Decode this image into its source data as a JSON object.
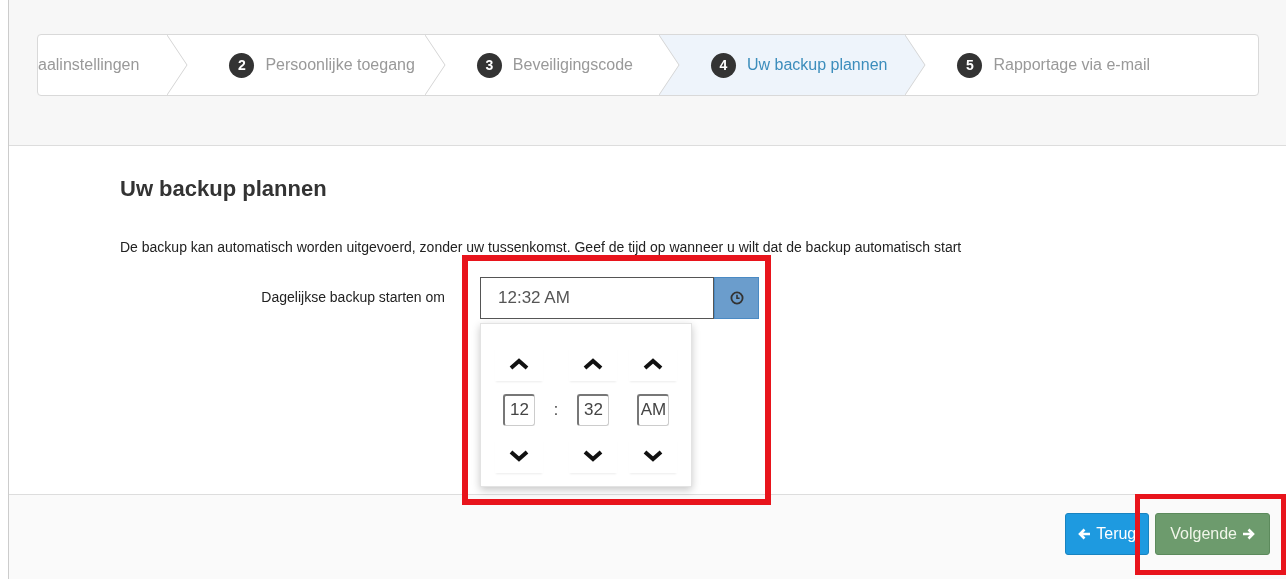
{
  "steps": [
    {
      "label": "aalinstellingen",
      "selected": false
    },
    {
      "number": "2",
      "label": "Persoonlijke toegang",
      "selected": false
    },
    {
      "number": "3",
      "label": "Beveiligingscode",
      "selected": false
    },
    {
      "number": "4",
      "label": "Uw backup plannen",
      "selected": true
    },
    {
      "number": "5",
      "label": "Rapportage via e-mail",
      "selected": false
    }
  ],
  "heading": "Uw backup plannen",
  "description": "De backup kan automatisch worden uitgevoerd, zonder uw tussenkomst. Geef de tijd op wanneer u wilt dat de backup automatisch start",
  "time_field": {
    "label": "Dagelijkse backup starten om",
    "value": "12:32 AM",
    "highlighted": true,
    "picker": {
      "hour": "12",
      "separator": ":",
      "minute": "32",
      "period": "AM"
    }
  },
  "buttons": [
    {
      "kind": "back",
      "label": "Terug",
      "highlighted": false
    },
    {
      "kind": "next",
      "label": "Volgende",
      "highlighted": true
    }
  ]
}
